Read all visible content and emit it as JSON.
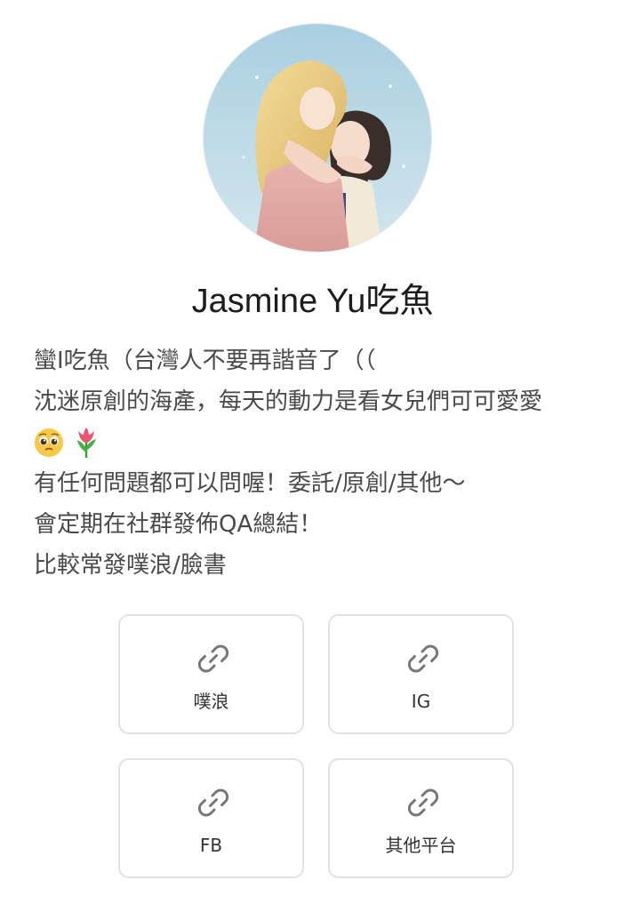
{
  "profile": {
    "name": "Jasmine Yu吃魚",
    "avatar_icon": "profile-illustration",
    "bio_lines": [
      "蠻I吃魚（台灣人不要再諧音了（（",
      "沈迷原創的海產，每天的動力是看女兒們可可愛愛",
      "🥹🌷",
      "有任何問題都可以問喔！委託/原創/其他～",
      "會定期在社群發佈QA總結！",
      "比較常發噗浪/臉書"
    ]
  },
  "links": [
    {
      "label": "噗浪",
      "icon": "link-icon"
    },
    {
      "label": "IG",
      "icon": "link-icon"
    },
    {
      "label": "FB",
      "icon": "link-icon"
    },
    {
      "label": "其他平台",
      "icon": "link-icon"
    }
  ],
  "colors": {
    "name_text": "#1c1c1c",
    "bio_text": "#4a4a4a",
    "card_border": "#e2e2e2",
    "icon_gray": "#777777"
  }
}
